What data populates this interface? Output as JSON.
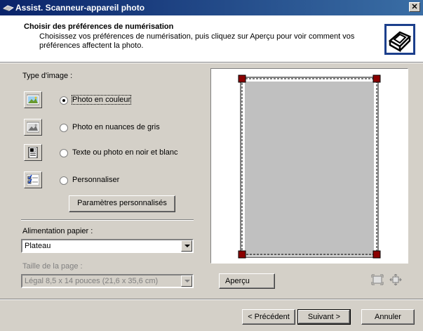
{
  "window": {
    "title": "Assist. Scanneur-appareil photo",
    "close_glyph": "✕"
  },
  "header": {
    "title": "Choisir des préférences de numérisation",
    "subtitle": "Choisissez vos préférences de numérisation, puis cliquez sur Aperçu pour voir comment vos préférences affectent la photo.",
    "icon": "scanner-camera-icon"
  },
  "image_type": {
    "label": "Type d'image :",
    "options": [
      {
        "label": "Photo en couleur",
        "icon": "color-photo-icon",
        "checked": true
      },
      {
        "label": "Photo en nuances de gris",
        "icon": "grayscale-photo-icon",
        "checked": false
      },
      {
        "label": "Texte ou photo en noir et blanc",
        "icon": "bw-text-icon",
        "checked": false
      },
      {
        "label": "Personnaliser",
        "icon": "custom-settings-icon",
        "checked": false
      }
    ],
    "custom_button": "Paramètres personnalisés"
  },
  "paper_source": {
    "label": "Alimentation papier :",
    "value": "Plateau"
  },
  "page_size": {
    "label": "Taille de la page :",
    "value": "Légal 8,5 x 14 pouces (21,6 x 35,6 cm)",
    "disabled": true
  },
  "preview": {
    "button": "Aperçu",
    "icons": [
      "zoom-fit-icon",
      "zoom-in-icon"
    ]
  },
  "nav": {
    "back": "< Précédent",
    "next": "Suivant >",
    "cancel": "Annuler"
  },
  "colors": {
    "title_start": "#0a246a",
    "title_end": "#3a6ea5",
    "face": "#d4d0c8",
    "scan_area": "#c0c0c0",
    "handle": "#8b0000"
  }
}
